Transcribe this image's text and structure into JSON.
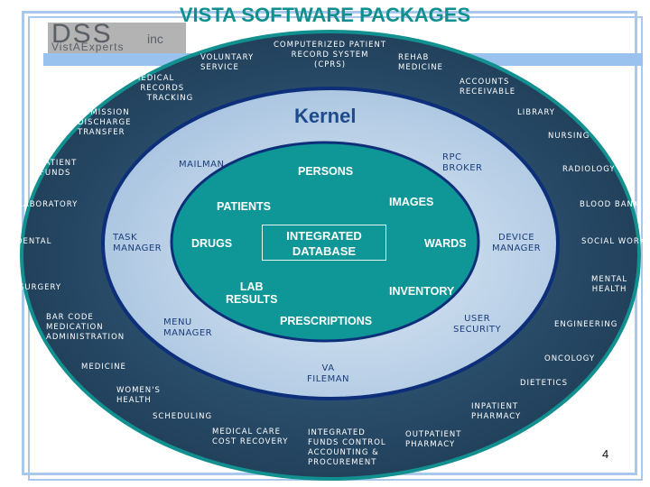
{
  "title": "VISTA SOFTWARE PACKAGES",
  "logo": {
    "main": "DSS",
    "suffix": "inc",
    "tagline": "VistAExperts"
  },
  "colors": {
    "outer_ring": "#274a66",
    "outer_ring_edge": "#129090",
    "middle_ring": "#b8d0e8",
    "middle_ring_edge": "#0d2f7a",
    "core": "#0f9696",
    "title": "#108f8f",
    "frame": "#a8c8ec"
  },
  "kernel_label": "Kernel",
  "database_label": "INTEGRATED\nDATABASE",
  "applications": [
    "VOLUNTARY\nSERVICE",
    "COMPUTERIZED PATIENT\nRECORD SYSTEM\n(CPRS)",
    "REHAB\nMEDICINE",
    "MEDICAL\n  RECORDS\n    TRACKING",
    "ACCOUNTS\nRECEIVABLE",
    "ADMISSION\nDISCHARGE\nTRANSFER",
    "LIBRARY",
    "NURSING",
    "PATIENT\nFUNDS",
    "RADIOLOGY",
    "LABORATORY",
    "BLOOD BANK",
    "DENTAL",
    "SOCIAL WORK",
    "MENTAL\nHEALTH",
    "SURGERY",
    "BAR CODE\nMEDICATION\nADMINISTRATION",
    "ENGINEERING",
    "ONCOLOGY",
    "MEDICINE",
    "DIETETICS",
    "WOMEN'S\nHEALTH",
    "INPATIENT\nPHARMACY",
    "SCHEDULING",
    "MEDICAL CARE\nCOST RECOVERY",
    "INTEGRATED\nFUNDS CONTROL\nACCOUNTING &\nPROCUREMENT",
    "OUTPATIENT\nPHARMACY"
  ],
  "kernel_components": [
    "MAILMAN",
    "RPC\nBROKER",
    "TASK\nMANAGER",
    "DEVICE\nMANAGER",
    "MENU\nMANAGER",
    "USER\nSECURITY",
    "VA\nFILEMAN"
  ],
  "database_files": [
    "PERSONS",
    "PATIENTS",
    "IMAGES",
    "DRUGS",
    "WARDS",
    "LAB\nRESULTS",
    "INVENTORY",
    "PRESCRIPTIONS"
  ],
  "page_number": "4"
}
